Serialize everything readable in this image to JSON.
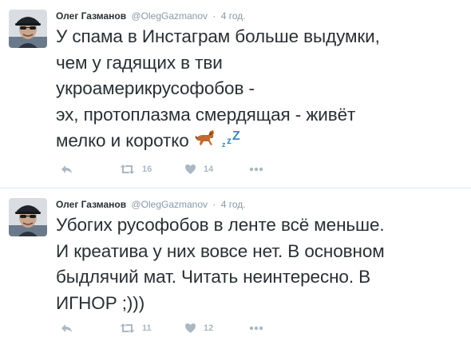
{
  "tweets": [
    {
      "author": {
        "fullname": "Олег Газманов",
        "username": "@OlegGazmanov"
      },
      "separator": "·",
      "time": "4 год.",
      "text": "У спама в Инстаграм больше выдумки,\nчем у гадящих в тви\nукроамерикрусофобов -\nэх, протоплазма смердящая - живёт\nмелко и коротко",
      "emoji": [
        "horse-emoji",
        "zzz-emoji"
      ],
      "actions": {
        "reply_icon": "reply-icon",
        "retweet_icon": "retweet-icon",
        "retweet_count": "16",
        "like_icon": "heart-icon",
        "like_count": "14",
        "more_icon": "more-icon"
      }
    },
    {
      "author": {
        "fullname": "Олег Газманов",
        "username": "@OlegGazmanov"
      },
      "separator": "·",
      "time": "4 год.",
      "text": "Убогих русофобов в ленте всё меньше.\nИ креатива у них вовсе нет. В основном\nбыдлячий мат. Читать неинтересно. В\nИГНОР ;)))",
      "actions": {
        "reply_icon": "reply-icon",
        "retweet_icon": "retweet-icon",
        "retweet_count": "11",
        "like_icon": "heart-icon",
        "like_count": "12",
        "more_icon": "more-icon"
      }
    }
  ],
  "colors": {
    "text": "#292f33",
    "meta": "#8899a6",
    "action": "#aab8c2",
    "divider": "#e1e8ed",
    "horse": "#c1692f",
    "zzz": "#3b88c3"
  }
}
